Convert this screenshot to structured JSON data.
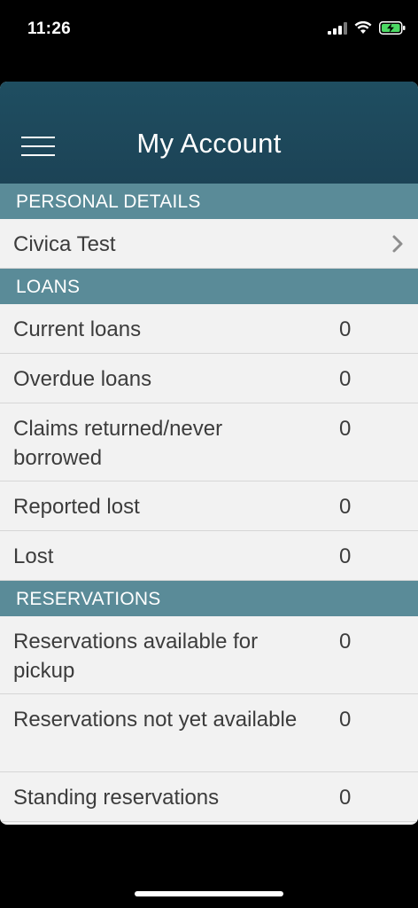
{
  "status_bar": {
    "time": "11:26"
  },
  "header": {
    "title": "My Account",
    "menu_icon": "hamburger-menu-icon"
  },
  "sections": [
    {
      "title": "PERSONAL DETAILS",
      "rows": [
        {
          "label": "Civica Test",
          "chevron": true
        }
      ]
    },
    {
      "title": "LOANS",
      "rows": [
        {
          "label": "Current loans",
          "value": "0"
        },
        {
          "label": "Overdue loans",
          "value": "0"
        },
        {
          "label": "Claims returned/never borrowed",
          "value": "0"
        },
        {
          "label": "Reported lost",
          "value": "0"
        },
        {
          "label": "Lost",
          "value": "0"
        }
      ]
    },
    {
      "title": "RESERVATIONS",
      "rows": [
        {
          "label": "Reservations available for pickup",
          "value": "0"
        },
        {
          "label": "Reservations not yet available",
          "value": "0"
        },
        {
          "label": "Standing reservations",
          "value": "0"
        }
      ]
    }
  ],
  "colors": {
    "header_bg": "#1f4e61",
    "section_bg": "#5a8b98",
    "row_bg": "#f2f2f2"
  }
}
